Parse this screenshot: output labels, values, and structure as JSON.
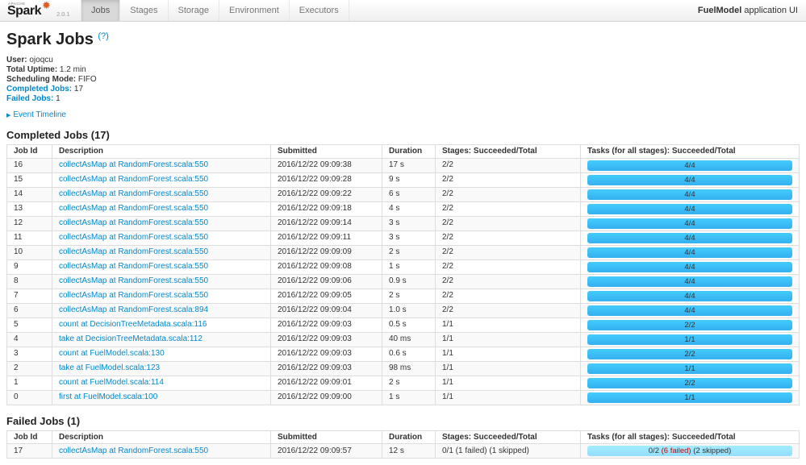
{
  "nav": {
    "logo": {
      "apache": "APACHE",
      "brand": "Spark",
      "version": "2.0.1"
    },
    "tabs": [
      {
        "label": "Jobs",
        "active": true
      },
      {
        "label": "Stages",
        "active": false
      },
      {
        "label": "Storage",
        "active": false
      },
      {
        "label": "Environment",
        "active": false
      },
      {
        "label": "Executors",
        "active": false
      }
    ],
    "app_name": "FuelModel",
    "app_suffix": " application UI"
  },
  "icons": {
    "spark_star": "✹",
    "help_link": "(?)",
    "expand_arrow": "▶"
  },
  "page": {
    "title": "Spark Jobs"
  },
  "summary": {
    "items": [
      {
        "label": "User:",
        "value": "ojoqcu",
        "is_link": false
      },
      {
        "label": "Total Uptime:",
        "value": "1.2 min",
        "is_link": false
      },
      {
        "label": "Scheduling Mode:",
        "value": "FIFO",
        "is_link": false
      },
      {
        "label": "Completed Jobs:",
        "value": "17",
        "is_link": true
      },
      {
        "label": "Failed Jobs:",
        "value": "1",
        "is_link": true
      }
    ]
  },
  "event_timeline": {
    "label": "Event Timeline"
  },
  "table_headers": [
    "Job Id",
    "Description",
    "Submitted",
    "Duration",
    "Stages: Succeeded/Total",
    "Tasks (for all stages): Succeeded/Total"
  ],
  "completed": {
    "title": "Completed Jobs (17)",
    "rows": [
      {
        "id": "16",
        "desc": "collectAsMap at RandomForest.scala:550",
        "submitted": "2016/12/22 09:09:38",
        "duration": "17 s",
        "stages": "2/2",
        "tasks": "4/4",
        "bar": "completed",
        "pct": 100
      },
      {
        "id": "15",
        "desc": "collectAsMap at RandomForest.scala:550",
        "submitted": "2016/12/22 09:09:28",
        "duration": "9 s",
        "stages": "2/2",
        "tasks": "4/4",
        "bar": "completed",
        "pct": 100
      },
      {
        "id": "14",
        "desc": "collectAsMap at RandomForest.scala:550",
        "submitted": "2016/12/22 09:09:22",
        "duration": "6 s",
        "stages": "2/2",
        "tasks": "4/4",
        "bar": "completed",
        "pct": 100
      },
      {
        "id": "13",
        "desc": "collectAsMap at RandomForest.scala:550",
        "submitted": "2016/12/22 09:09:18",
        "duration": "4 s",
        "stages": "2/2",
        "tasks": "4/4",
        "bar": "completed",
        "pct": 100
      },
      {
        "id": "12",
        "desc": "collectAsMap at RandomForest.scala:550",
        "submitted": "2016/12/22 09:09:14",
        "duration": "3 s",
        "stages": "2/2",
        "tasks": "4/4",
        "bar": "completed",
        "pct": 100
      },
      {
        "id": "11",
        "desc": "collectAsMap at RandomForest.scala:550",
        "submitted": "2016/12/22 09:09:11",
        "duration": "3 s",
        "stages": "2/2",
        "tasks": "4/4",
        "bar": "completed",
        "pct": 100
      },
      {
        "id": "10",
        "desc": "collectAsMap at RandomForest.scala:550",
        "submitted": "2016/12/22 09:09:09",
        "duration": "2 s",
        "stages": "2/2",
        "tasks": "4/4",
        "bar": "completed",
        "pct": 100
      },
      {
        "id": "9",
        "desc": "collectAsMap at RandomForest.scala:550",
        "submitted": "2016/12/22 09:09:08",
        "duration": "1 s",
        "stages": "2/2",
        "tasks": "4/4",
        "bar": "completed",
        "pct": 100
      },
      {
        "id": "8",
        "desc": "collectAsMap at RandomForest.scala:550",
        "submitted": "2016/12/22 09:09:06",
        "duration": "0.9 s",
        "stages": "2/2",
        "tasks": "4/4",
        "bar": "completed",
        "pct": 100
      },
      {
        "id": "7",
        "desc": "collectAsMap at RandomForest.scala:550",
        "submitted": "2016/12/22 09:09:05",
        "duration": "2 s",
        "stages": "2/2",
        "tasks": "4/4",
        "bar": "completed",
        "pct": 100
      },
      {
        "id": "6",
        "desc": "collectAsMap at RandomForest.scala:894",
        "submitted": "2016/12/22 09:09:04",
        "duration": "1.0 s",
        "stages": "2/2",
        "tasks": "4/4",
        "bar": "completed",
        "pct": 100
      },
      {
        "id": "5",
        "desc": "count at DecisionTreeMetadata.scala:116",
        "submitted": "2016/12/22 09:09:03",
        "duration": "0.5 s",
        "stages": "1/1",
        "tasks": "2/2",
        "bar": "completed",
        "pct": 100
      },
      {
        "id": "4",
        "desc": "take at DecisionTreeMetadata.scala:112",
        "submitted": "2016/12/22 09:09:03",
        "duration": "40 ms",
        "stages": "1/1",
        "tasks": "1/1",
        "bar": "completed",
        "pct": 100
      },
      {
        "id": "3",
        "desc": "count at FuelModel.scala:130",
        "submitted": "2016/12/22 09:09:03",
        "duration": "0.6 s",
        "stages": "1/1",
        "tasks": "2/2",
        "bar": "completed",
        "pct": 100
      },
      {
        "id": "2",
        "desc": "take at FuelModel.scala:123",
        "submitted": "2016/12/22 09:09:03",
        "duration": "98 ms",
        "stages": "1/1",
        "tasks": "1/1",
        "bar": "completed",
        "pct": 100
      },
      {
        "id": "1",
        "desc": "count at FuelModel.scala:114",
        "submitted": "2016/12/22 09:09:01",
        "duration": "2 s",
        "stages": "1/1",
        "tasks": "2/2",
        "bar": "completed",
        "pct": 100
      },
      {
        "id": "0",
        "desc": "first at FuelModel.scala:100",
        "submitted": "2016/12/22 09:09:00",
        "duration": "1 s",
        "stages": "1/1",
        "tasks": "1/1",
        "bar": "completed",
        "pct": 100
      }
    ]
  },
  "failed": {
    "title": "Failed Jobs (1)",
    "rows": [
      {
        "id": "17",
        "desc": "collectAsMap at RandomForest.scala:550",
        "submitted": "2016/12/22 09:09:57",
        "duration": "12 s",
        "stages": "0/1 (1 failed) (1 skipped)",
        "tasks": "0/2",
        "tasks_failed": "(6 failed)",
        "tasks_skipped": "(2 skipped)",
        "bar": "running",
        "pct": 100
      }
    ]
  },
  "colors": {
    "link": "#0088cc",
    "bar_completed": "#3EC0FF",
    "bar_running": "#A0DFFF",
    "failed_text": "#cc0000",
    "accent_star": "#e25a1c"
  }
}
